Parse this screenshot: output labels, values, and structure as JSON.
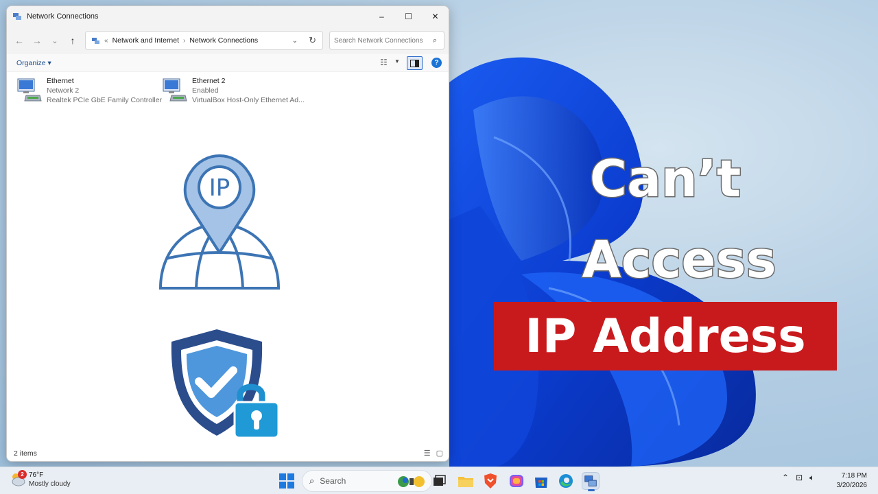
{
  "window": {
    "title": "Network Connections",
    "controls": {
      "minimize": "–",
      "maximize": "☐",
      "close": "✕"
    }
  },
  "navigation": {
    "back": "←",
    "forward": "→",
    "recent": "⌄",
    "up": "↑",
    "address": {
      "overflow": "«",
      "crumbs": [
        "Network and Internet",
        "Network Connections"
      ],
      "separator": "›"
    },
    "search_placeholder": "Search Network Connections"
  },
  "command_bar": {
    "organize_label": "Organize ▾"
  },
  "adapters": [
    {
      "name": "Ethernet",
      "status": "Network 2",
      "device": "Realtek PCIe GbE Family Controller"
    },
    {
      "name": "Ethernet 2",
      "status": "Enabled",
      "device": "VirtualBox Host-Only Ethernet Ad..."
    }
  ],
  "ip_badge": "IP",
  "status_bar": {
    "item_count": "2 items"
  },
  "headline": {
    "line1": "Can’t",
    "line2": "Access",
    "line3": "IP Address"
  },
  "colors": {
    "accent_red": "#c81a1d",
    "icon_blue": "#3c74b4",
    "shield_navy": "#2b4d8c"
  },
  "taskbar": {
    "weather": {
      "temp": "76°F",
      "condition": "Mostly cloudy",
      "badge": "2"
    },
    "search_label": "Search",
    "apps": [
      "file-explorer",
      "brave-browser",
      "copilot",
      "microsoft-store",
      "edge",
      "network-settings"
    ],
    "clock": {
      "time": "7:18 PM",
      "date": "3/20/2026"
    }
  }
}
